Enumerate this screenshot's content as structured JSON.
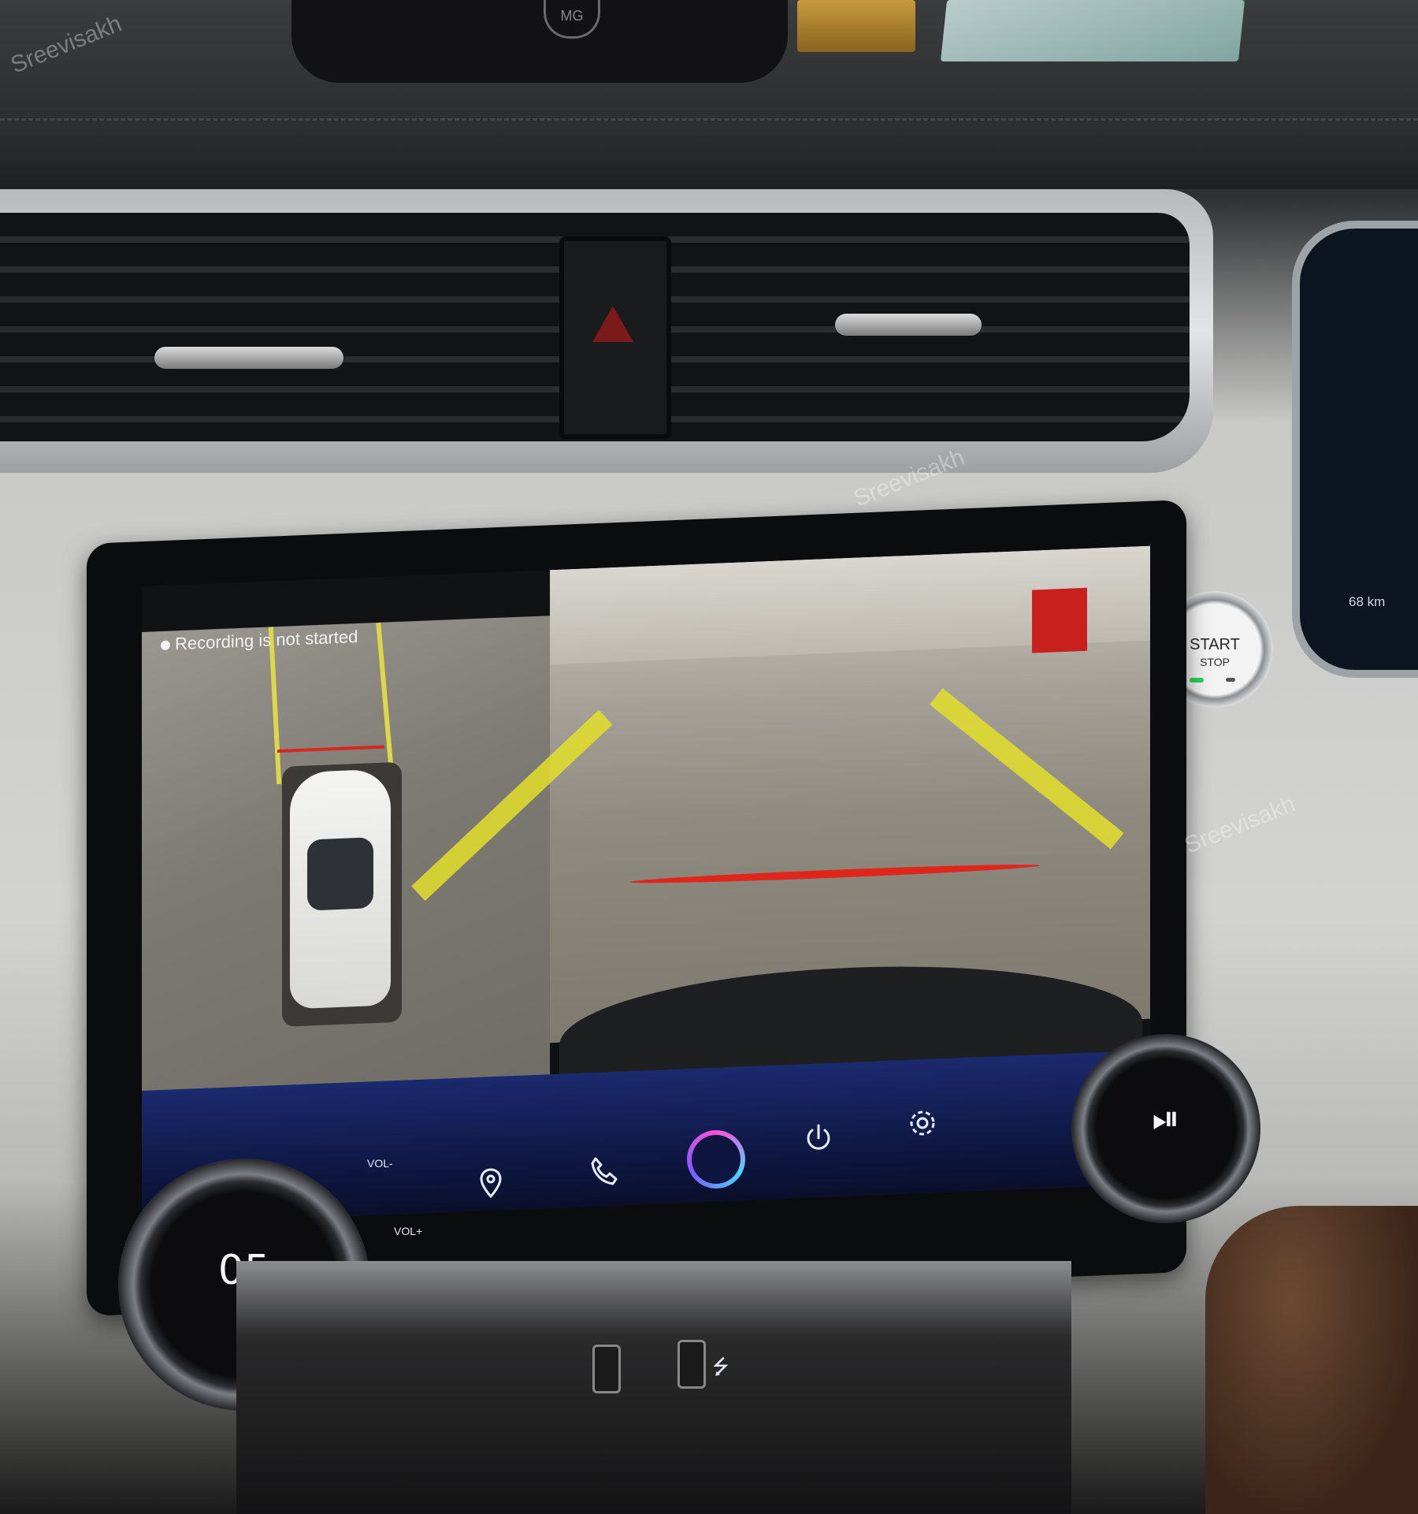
{
  "hud": {
    "logo": "MG"
  },
  "status": {
    "range": "68 km"
  },
  "start_button": {
    "start_label": "START",
    "stop_label": "STOP"
  },
  "surround_view": {
    "recording_status": "Recording is not started"
  },
  "control_bar": {
    "vol_minus": "VOL-",
    "vol_plus": "VOL+",
    "icons": [
      "navigation-icon",
      "phone-icon",
      "voice-assistant-icon",
      "power-icon",
      "settings-icon"
    ]
  },
  "left_knob": {
    "value": "05"
  },
  "right_knob": {
    "symbol": "⏯"
  },
  "watermark": "Sreevisakh",
  "colors": {
    "guide_yellow": "#e3df2a",
    "guide_red": "#e0251b",
    "bar_blue": "#1b2a6e",
    "start_led": "#2bd35a"
  }
}
